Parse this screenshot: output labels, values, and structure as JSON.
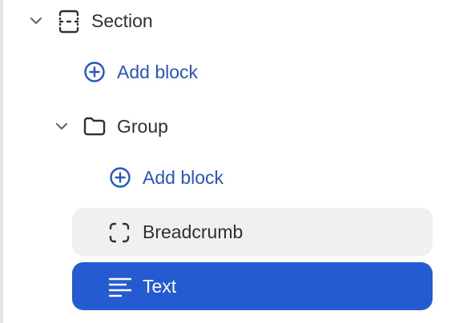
{
  "tree": {
    "section": {
      "label": "Section",
      "icon": "section-icon",
      "expanded": true
    },
    "section_add_block": {
      "label": "Add block",
      "icon": "plus-circle-icon"
    },
    "group": {
      "label": "Group",
      "icon": "folder-icon",
      "expanded": true
    },
    "group_add_block": {
      "label": "Add block",
      "icon": "plus-circle-icon"
    },
    "breadcrumb": {
      "label": "Breadcrumb",
      "icon": "block-frame-icon",
      "state": "hover"
    },
    "text": {
      "label": "Text",
      "icon": "text-lines-icon",
      "state": "selected"
    }
  },
  "colors": {
    "accent": "#255bd0",
    "link": "#2556c6",
    "hover_bg": "#f0f0f0",
    "text": "#303030",
    "icon": "#303030"
  }
}
